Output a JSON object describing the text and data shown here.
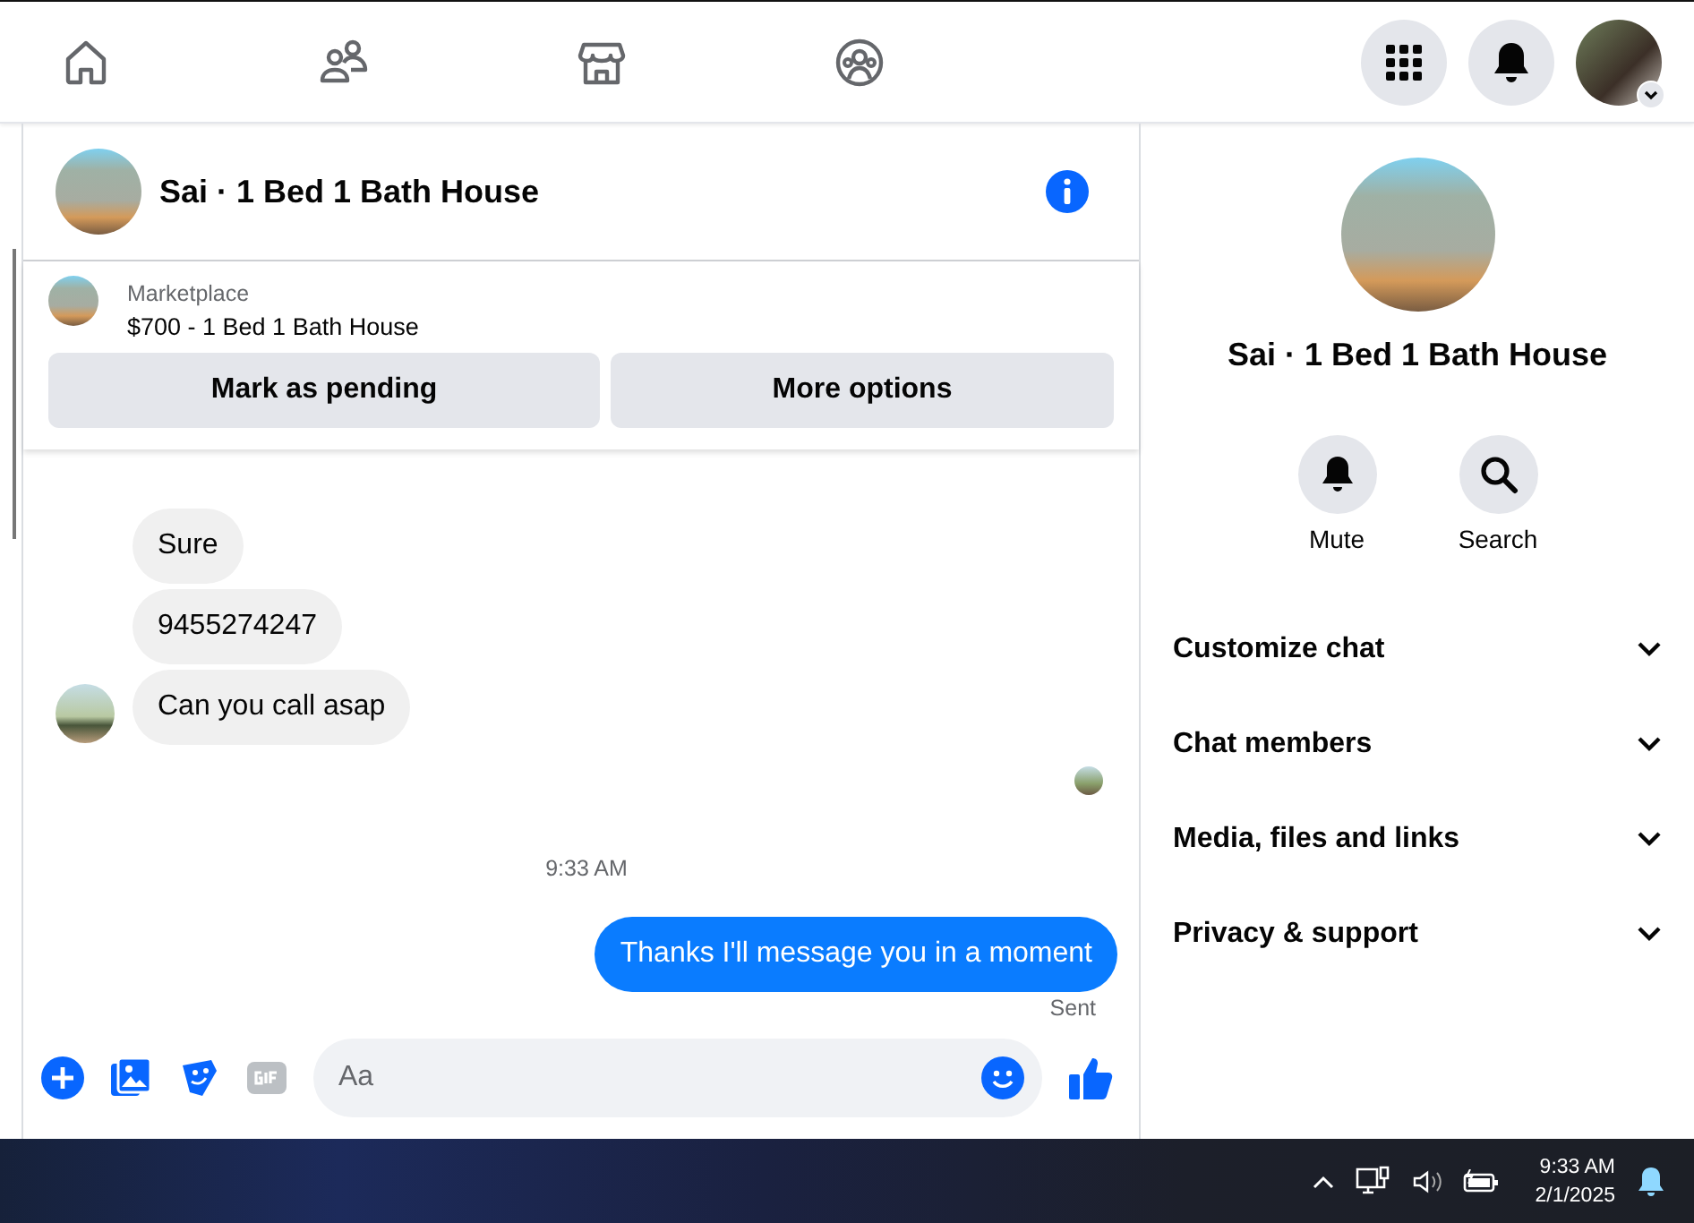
{
  "chat": {
    "title": "Sai · 1 Bed 1 Bath House",
    "listing": {
      "label": "Marketplace",
      "price": "$700 - 1 Bed 1 Bath House",
      "buttons": [
        "Mark as pending",
        "More options"
      ]
    },
    "messages": [
      {
        "kind": "received",
        "text": "Sure"
      },
      {
        "kind": "received",
        "text": "9455274247"
      },
      {
        "kind": "received",
        "text": "Can you call asap"
      },
      {
        "kind": "seen"
      },
      {
        "kind": "time",
        "text": "9:33 AM"
      },
      {
        "kind": "sent",
        "text": "Thanks I'll message you in a moment",
        "status": "Sent"
      }
    ],
    "composer": {
      "placeholder": "Aa"
    }
  },
  "details": {
    "name": "Sai · 1 Bed 1 Bath House",
    "actions": [
      {
        "kind": "mute",
        "label": "Mute"
      },
      {
        "kind": "search",
        "label": "Search"
      }
    ],
    "sections": [
      {
        "label": "Customize chat",
        "expanded": false
      },
      {
        "label": "Chat members",
        "expanded": false
      },
      {
        "label": "Media, files and links",
        "expanded": false
      },
      {
        "label": "Privacy & support",
        "expanded": false
      }
    ]
  },
  "taskbar": {
    "time": "9:33 AM",
    "date": "2/1/2025"
  }
}
